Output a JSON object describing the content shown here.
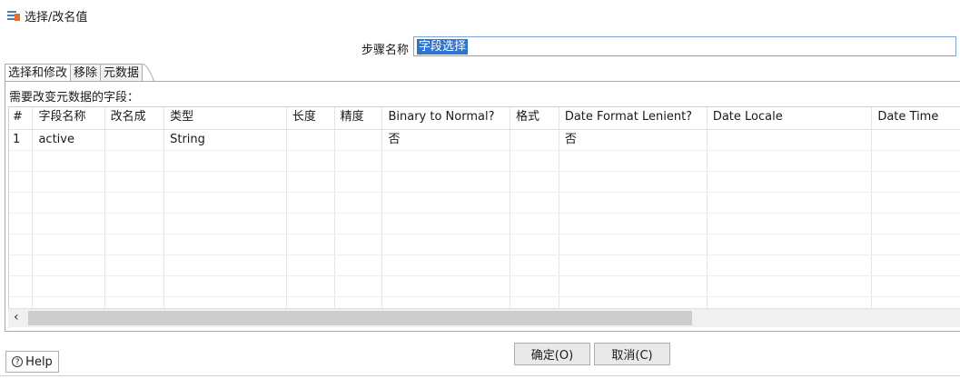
{
  "window": {
    "title": "选择/改名值",
    "icon": "select-rename-icon"
  },
  "step": {
    "label": "步骤名称",
    "value": "字段选择"
  },
  "tabs": [
    {
      "label": "选择和修改"
    },
    {
      "label": "移除"
    },
    {
      "label": "元数据"
    }
  ],
  "fields_label": "需要改变元数据的字段：",
  "table": {
    "columns": [
      "#",
      "字段名称",
      "改名成",
      "类型",
      "长度",
      "精度",
      "Binary to Normal?",
      "格式",
      "Date Format Lenient?",
      "Date Locale",
      "Date Time"
    ],
    "rows": [
      [
        "1",
        "active",
        "",
        "String",
        "",
        "",
        "否",
        "",
        "否",
        "",
        ""
      ]
    ]
  },
  "buttons": {
    "help": "Help",
    "ok": "确定(O)",
    "cancel": "取消(C)"
  },
  "colors": {
    "selection": "#3074d0",
    "input_border": "#7aa7d8"
  }
}
